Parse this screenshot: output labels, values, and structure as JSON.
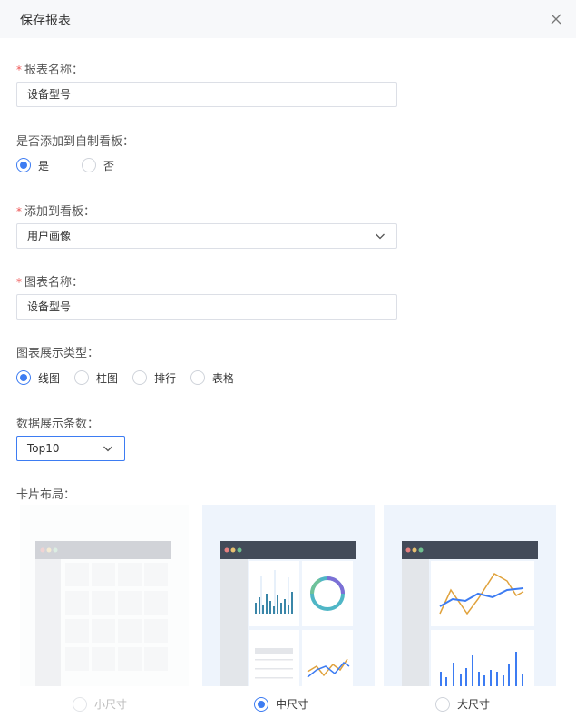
{
  "dialog": {
    "title": "保存报表"
  },
  "form": {
    "report_name": {
      "label": "报表名称：",
      "value": "设备型号",
      "required": true
    },
    "add_to_board": {
      "label": "是否添加到自制看板：",
      "options": [
        {
          "label": "是",
          "selected": true
        },
        {
          "label": "否",
          "selected": false
        }
      ]
    },
    "board": {
      "label": "添加到看板：",
      "value": "用户画像",
      "required": true
    },
    "chart_name": {
      "label": "图表名称：",
      "value": "设备型号",
      "required": true
    },
    "chart_type": {
      "label": "图表展示类型：",
      "options": [
        {
          "label": "线图",
          "selected": true
        },
        {
          "label": "柱图",
          "selected": false
        },
        {
          "label": "排行",
          "selected": false
        },
        {
          "label": "表格",
          "selected": false
        }
      ]
    },
    "data_count": {
      "label": "数据展示条数：",
      "value": "Top10"
    },
    "card_layout": {
      "label": "卡片布局：",
      "options": [
        {
          "label": "小尺寸",
          "selected": false,
          "disabled": true
        },
        {
          "label": "中尺寸",
          "selected": true,
          "disabled": false
        },
        {
          "label": "大尺寸",
          "selected": false,
          "disabled": false
        }
      ]
    }
  },
  "colors": {
    "primary": "#3d7cf2",
    "required": "#ee5555",
    "preview_header": "#434b59",
    "chart_teal": "#4fb6c6",
    "chart_blue": "#3d7cf2",
    "chart_orange": "#e0a23c"
  }
}
